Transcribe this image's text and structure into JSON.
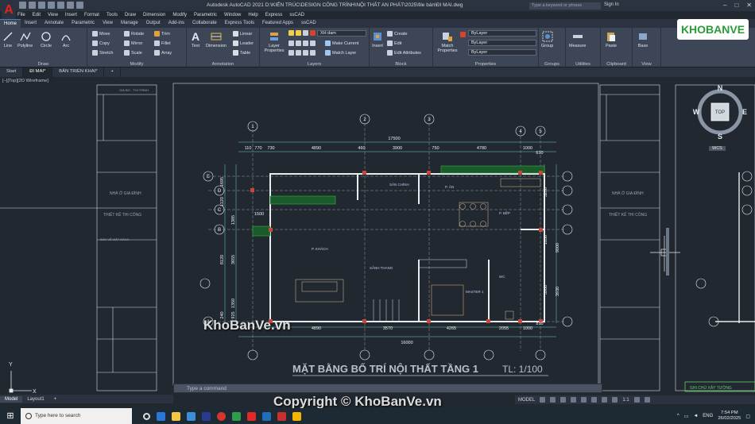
{
  "window": {
    "title": "Autodesk AutoCAD 2021    D:\\KIẾN TRÚC\\DESIGN CÔNG TRÌNH\\NỘI THẤT AN PHÁT\\2025\\file bán\\ĐI MAI.dwg",
    "search_placeholder": "Type a keyword or phrase",
    "sign_in": "Sign In"
  },
  "menu": [
    "File",
    "Edit",
    "View",
    "Insert",
    "Format",
    "Tools",
    "Draw",
    "Dimension",
    "Modify",
    "Parametric",
    "Window",
    "Help",
    "Express",
    "ssCAD"
  ],
  "ribbon_tabs": [
    "Home",
    "Insert",
    "Annotate",
    "Parametric",
    "View",
    "Manage",
    "Output",
    "Add-ins",
    "Collaborate",
    "Express Tools",
    "Featured Apps",
    "ssCAD"
  ],
  "ribbon": {
    "draw": {
      "title": "Draw",
      "line": "Line",
      "polyline": "Polyline",
      "circle": "Circle",
      "arc": "Arc"
    },
    "modify": {
      "title": "Modify",
      "move": "Move",
      "rotate": "Rotate",
      "trim": "Trim",
      "copy": "Copy",
      "mirror": "Mirror",
      "fillet": "Fillet",
      "stretch": "Stretch",
      "scale": "Scale",
      "array": "Array"
    },
    "annotation": {
      "title": "Annotation",
      "text": "Text",
      "dimension": "Dimension",
      "linear": "Linear",
      "leader": "Leader",
      "table": "Table"
    },
    "layers": {
      "title": "Layers",
      "layer_properties": "Layer Properties",
      "layer_name": "XH dam",
      "make_current": "Make Current",
      "match_layer": "Match Layer"
    },
    "block": {
      "title": "Block",
      "insert": "Insert",
      "create": "Create",
      "edit": "Edit",
      "edit_attributes": "Edit Attributes"
    },
    "properties": {
      "title": "Properties",
      "match": "Match Properties",
      "bylayer1": "ByLayer",
      "bylayer2": "ByLayer",
      "bylayer3": "ByLayer"
    },
    "groups": {
      "title": "Groups",
      "group": "Group"
    },
    "utilities": {
      "title": "Utilities",
      "measure": "Measure"
    },
    "clipboard": {
      "title": "Clipboard",
      "paste": "Paste"
    },
    "view": {
      "title": "View",
      "base": "Base"
    }
  },
  "doc_tabs": [
    "Start",
    "ĐI MAI*",
    "BẢN TRIỂN KHAI*"
  ],
  "viewport_label": "[–][Top][2D Wireframe]",
  "viewcube": {
    "n": "N",
    "s": "S",
    "e": "E",
    "w": "W",
    "top": "TOP",
    "wcs": "WCS"
  },
  "drawing": {
    "title": "MẶT BẰNG BỐ TRÍ NỘI THẤT TẦNG 1",
    "scale": "TL: 1/100",
    "dims_top_total": "17500",
    "dims_top": [
      "110",
      "770",
      "730",
      "4890",
      "460",
      "3900",
      "750",
      "4780",
      "1000",
      "610"
    ],
    "dims_bottom_total": "16000",
    "dims_bottom": [
      "4890",
      "3570",
      "4265",
      "2055",
      "1000",
      "810"
    ],
    "dims_left": [
      "1695",
      "1120",
      "1385",
      "8120",
      "3655",
      "1350",
      "925",
      "240",
      "1500"
    ],
    "dims_right": [
      "3200",
      "1850",
      "3900",
      "3930",
      "9000"
    ],
    "grid_top": [
      "1",
      "2",
      "3",
      "4",
      "5"
    ],
    "grid_side": [
      "E",
      "D",
      "C",
      "B",
      "A"
    ],
    "rooms": [
      "SÂN CHÍNH",
      "P. KHÁCH",
      "SẢNH THANG",
      "P. BẾP",
      "WC",
      "MASTER 1",
      "P. ĂN"
    ],
    "titleblock": {
      "label1": "NHÀ Ở GIA ĐÌNH",
      "label2": "THIẾT KẾ THI CÔNG",
      "header": "GIÁ BỐ - THI TRÌNH",
      "footer": "BẢN VẼ MẶT BẰNG"
    },
    "right_sheet_title": "GHI CHÚ XÂY TƯỜNG"
  },
  "command_placeholder": "Type a command",
  "layout_tabs": [
    "Model",
    "Layout1",
    "+"
  ],
  "status": {
    "model": "MODEL",
    "scale": "1:1"
  },
  "taskbar": {
    "search": "Type here to search",
    "lang": "ENG",
    "time": "7:54 PM",
    "date": "26/02/2025"
  },
  "watermarks": {
    "left": "KhoBanVe.vn",
    "center": "Copyright © KhoBanVe.vn",
    "logo": "KHOBANVE"
  }
}
